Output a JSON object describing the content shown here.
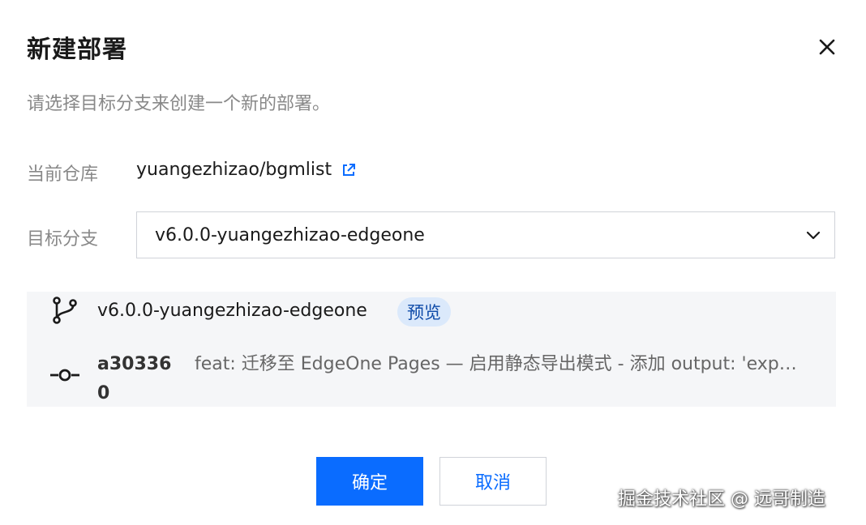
{
  "dialog": {
    "title": "新建部署",
    "subtitle": "请选择目标分支来创建一个新的部署。"
  },
  "repo": {
    "label": "当前仓库",
    "value": "yuangezhizao/bgmlist",
    "link_icon": "external-link-icon"
  },
  "branch_select": {
    "label": "目标分支",
    "selected": "v6.0.0-yuangezhizao-edgeone",
    "chevron_icon": "chevron-down-icon"
  },
  "branch_info": {
    "branch_icon": "git-branch-icon",
    "branch_name": "v6.0.0-yuangezhizao-edgeone",
    "badge": "预览",
    "commit_icon": "git-commit-icon",
    "commit_hash": "a303360",
    "commit_message": "feat: 迁移至 EdgeOne Pages — 启用静态导出模式 - 添加 output: 'export'"
  },
  "actions": {
    "confirm_label": "确定",
    "cancel_label": "取消"
  },
  "watermark": "掘金技术社区 @ 远哥制造",
  "colors": {
    "primary": "#0a6cff",
    "badge_bg": "#dbe9fb",
    "badge_text": "#0d4aa8",
    "panel_bg": "#f5f6f8",
    "muted_text": "#888888"
  }
}
